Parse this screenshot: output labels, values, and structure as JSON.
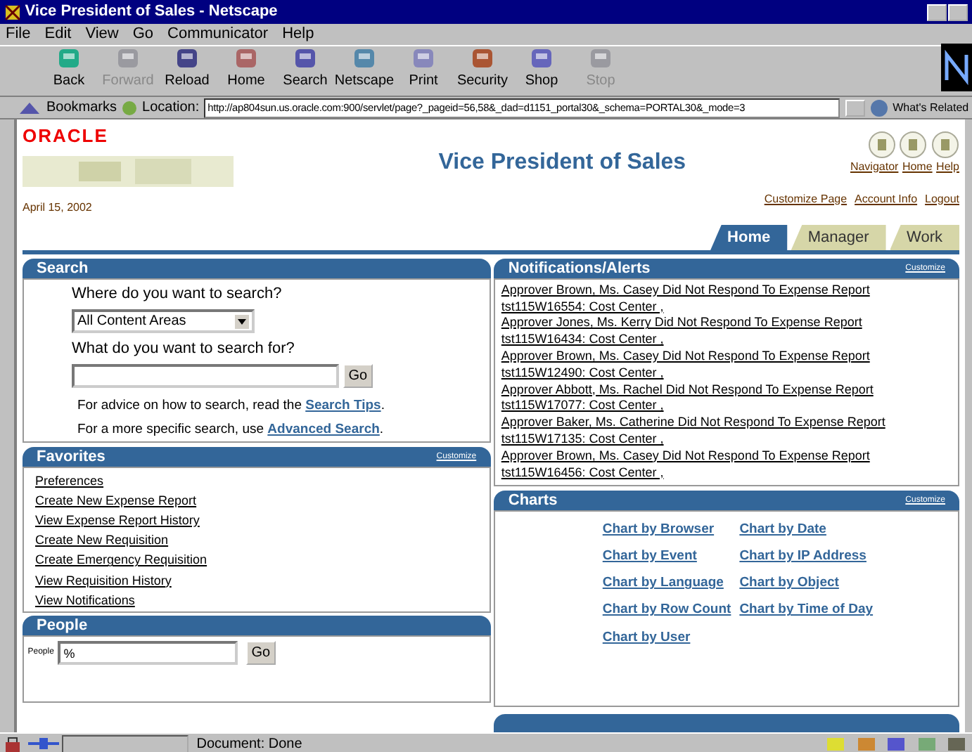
{
  "window": {
    "title": "Vice President of Sales - Netscape"
  },
  "menu": [
    "File",
    "Edit",
    "View",
    "Go",
    "Communicator",
    "Help"
  ],
  "toolbar": [
    {
      "label": "Back",
      "disabled": false
    },
    {
      "label": "Forward",
      "disabled": true
    },
    {
      "label": "Reload",
      "disabled": false
    },
    {
      "label": "Home",
      "disabled": false
    },
    {
      "label": "Search",
      "disabled": false
    },
    {
      "label": "Netscape",
      "disabled": false
    },
    {
      "label": "Print",
      "disabled": false
    },
    {
      "label": "Security",
      "disabled": false
    },
    {
      "label": "Shop",
      "disabled": false
    },
    {
      "label": "Stop",
      "disabled": true
    }
  ],
  "location_bar": {
    "bookmarks": "Bookmarks",
    "location_label": "Location:",
    "url": "http://ap804sun.us.oracle.com:900/servlet/page?_pageid=56,58&_dad=d1151_portal30&_schema=PORTAL30&_mode=3",
    "whats_related": "What's Related"
  },
  "portal": {
    "logo": "ORACLE",
    "title": "Vice President of Sales",
    "date": "April 15, 2002",
    "nav_links": [
      "Navigator",
      "Home",
      "Help"
    ],
    "page_links": [
      "Customize Page",
      "Account Info",
      "Logout"
    ],
    "tabs": [
      {
        "label": "Home",
        "selected": true
      },
      {
        "label": "Manager",
        "selected": false
      },
      {
        "label": "Work",
        "selected": false
      }
    ]
  },
  "search_panel": {
    "title": "Search",
    "where_label": "Where do you want to search?",
    "scope": "All Content Areas",
    "what_label": "What do you want to search for?",
    "go": "Go",
    "hints": [
      {
        "before": "For advice on how to search, read the ",
        "link": "Search Tips",
        "after": "."
      },
      {
        "before": "For a more specific search, use ",
        "link": "Advanced Search",
        "after": "."
      }
    ]
  },
  "favorites": {
    "title": "Favorites",
    "customize": "Customize",
    "items": [
      "Preferences",
      "Create New Expense Report",
      "View Expense Report History",
      "Create New Requisition",
      "Create Emergency Requisition",
      "View Requisition History",
      "View Notifications"
    ]
  },
  "people": {
    "title": "People",
    "label": "People",
    "value": "%",
    "go": "Go"
  },
  "notifications": {
    "title": "Notifications/Alerts",
    "customize": "Customize",
    "items": [
      {
        "text": "Approver Brown, Ms. Casey Did Not Respond To Expense Report",
        "detail": "tst115W16554: Cost Center ,"
      },
      {
        "text": "Approver Jones, Ms. Kerry Did Not Respond To Expense Report",
        "detail": "tst115W16434: Cost Center ,"
      },
      {
        "text": "Approver Brown, Ms. Casey Did Not Respond To Expense Report",
        "detail": "tst115W12490: Cost Center ,"
      },
      {
        "text": "Approver Abbott, Ms. Rachel Did Not Respond To Expense Report",
        "detail": "tst115W17077: Cost Center ,"
      },
      {
        "text": "Approver Baker, Ms. Catherine Did Not Respond To Expense Report",
        "detail": "tst115W17135: Cost Center ,"
      },
      {
        "text": "Approver Brown, Ms. Casey Did Not Respond To Expense Report",
        "detail": "tst115W16456: Cost Center ,"
      }
    ]
  },
  "charts": {
    "title": "Charts",
    "customize": "Customize",
    "links": [
      "Chart by Browser",
      "Chart by Date",
      "Chart by Event",
      "Chart by IP Address",
      "Chart by Language",
      "Chart by Object",
      "Chart by Row Count",
      "Chart by Time of Day",
      "Chart by User"
    ]
  },
  "status_bar": {
    "text": "Document: Done"
  }
}
